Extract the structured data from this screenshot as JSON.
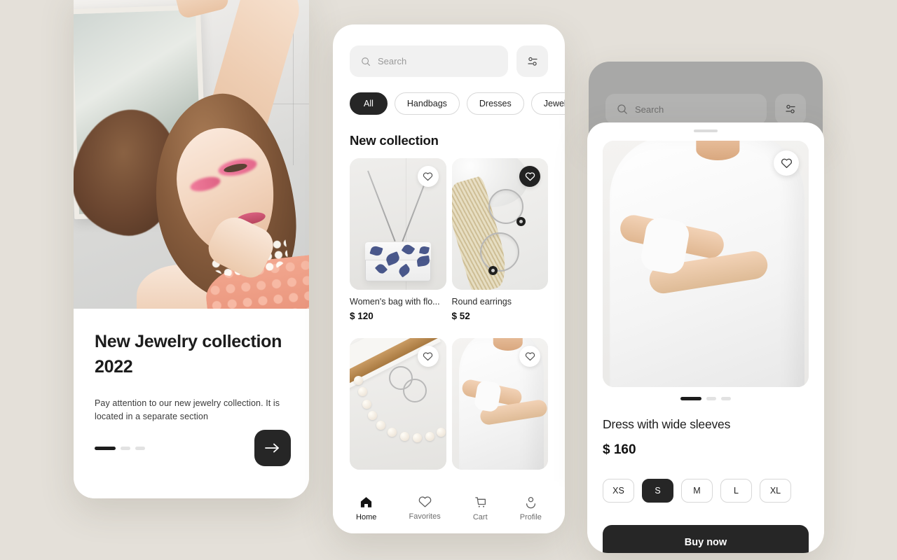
{
  "theme": {
    "canvas_bg": "#e4e0d9",
    "accent_dark": "#262626",
    "card_bg": "#ffffff",
    "muted_field": "#f1f1f1"
  },
  "onboarding": {
    "title": "New Jewelry collection 2022",
    "description": "Pay attention to our new jewelry collection. It is located in a separate section",
    "pagination": {
      "total": 3,
      "active_index": 0
    },
    "next_icon": "arrow-right-icon"
  },
  "catalog": {
    "search": {
      "placeholder": "Search",
      "value": "",
      "icon": "search-icon"
    },
    "filter_icon": "sliders-filter-icon",
    "chips": [
      {
        "label": "All",
        "active": true
      },
      {
        "label": "Handbags",
        "active": false
      },
      {
        "label": "Dresses",
        "active": false
      },
      {
        "label": "Jewellery",
        "active": false
      }
    ],
    "section_title": "New collection",
    "products": [
      {
        "name": "Women's bag with flo...",
        "price": "$ 120",
        "favorited": false
      },
      {
        "name": "Round earrings",
        "price": "$ 52",
        "favorited": true
      },
      {
        "name": "",
        "price": "",
        "favorited": false
      },
      {
        "name": "",
        "price": "",
        "favorited": false
      }
    ],
    "tabs": [
      {
        "label": "Home",
        "icon": "home-icon",
        "active": true
      },
      {
        "label": "Favorites",
        "icon": "heart-icon",
        "active": false
      },
      {
        "label": "Cart",
        "icon": "cart-icon",
        "active": false
      },
      {
        "label": "Profile",
        "icon": "person-icon",
        "active": false
      }
    ]
  },
  "product_detail": {
    "dimmed_search": {
      "placeholder": "Search",
      "icon": "search-icon"
    },
    "dimmed_filter_icon": "sliders-filter-icon",
    "favorite_icon": "heart-icon",
    "gallery": {
      "total": 3,
      "active_index": 0
    },
    "name": "Dress with wide sleeves",
    "price": "$ 160",
    "sizes": [
      {
        "label": "XS",
        "selected": false
      },
      {
        "label": "S",
        "selected": true
      },
      {
        "label": "M",
        "selected": false
      },
      {
        "label": "L",
        "selected": false
      },
      {
        "label": "XL",
        "selected": false
      }
    ],
    "buy_label": "Buy now"
  }
}
